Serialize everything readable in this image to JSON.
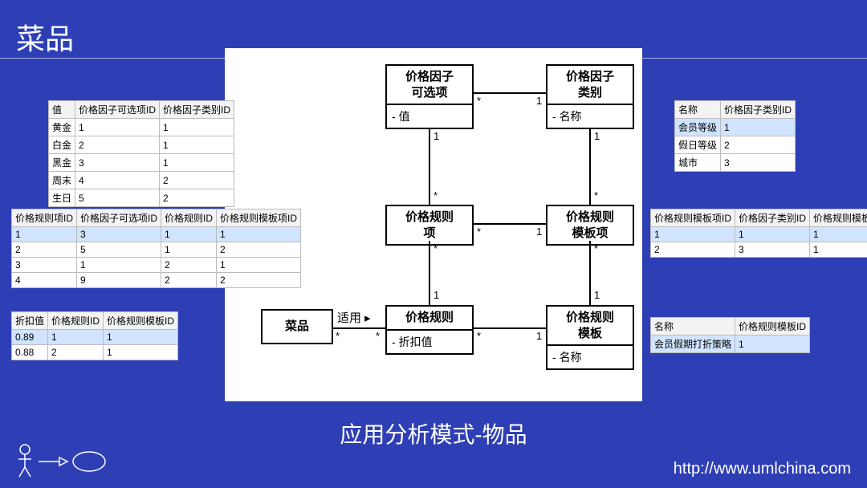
{
  "title": "菜品",
  "caption": "应用分析模式-物品",
  "footer_url": "http://www.umlchina.com",
  "uml": {
    "box1": {
      "title": "价格因子\n可选项",
      "attr": "值"
    },
    "box2": {
      "title": "价格因子\n类别",
      "attr": "名称"
    },
    "box3": {
      "title": "价格规则\n项"
    },
    "box4": {
      "title": "价格规则\n模板项"
    },
    "box5": {
      "title": "菜品"
    },
    "box6": {
      "title": "价格规则",
      "attr": "折扣值"
    },
    "box7": {
      "title": "价格规则\n模板",
      "attr": "名称"
    },
    "assoc_label": "适用 ▸"
  },
  "mult": {
    "one": "1",
    "many": "*"
  },
  "table1": {
    "headers": [
      "值",
      "价格因子可选项ID",
      "价格因子类别ID"
    ],
    "rows": [
      [
        "黄金",
        "1",
        "1"
      ],
      [
        "白金",
        "2",
        "1"
      ],
      [
        "黑金",
        "3",
        "1"
      ],
      [
        "周末",
        "4",
        "2"
      ],
      [
        "生日",
        "5",
        "2"
      ]
    ]
  },
  "table2": {
    "headers": [
      "价格规则项ID",
      "价格因子可选项ID",
      "价格规则ID",
      "价格规则模板项ID"
    ],
    "rows": [
      [
        "1",
        "3",
        "1",
        "1"
      ],
      [
        "2",
        "5",
        "1",
        "2"
      ],
      [
        "3",
        "1",
        "2",
        "1"
      ],
      [
        "4",
        "9",
        "2",
        "2"
      ]
    ]
  },
  "table3": {
    "headers": [
      "折扣值",
      "价格规则ID",
      "价格规则模板ID"
    ],
    "rows": [
      [
        "0.89",
        "1",
        "1"
      ],
      [
        "0.88",
        "2",
        "1"
      ]
    ]
  },
  "table4": {
    "headers": [
      "名称",
      "价格因子类别ID"
    ],
    "rows": [
      [
        "会员等级",
        "1"
      ],
      [
        "假日等级",
        "2"
      ],
      [
        "城市",
        "3"
      ]
    ]
  },
  "table5": {
    "headers": [
      "价格规则模板项ID",
      "价格因子类别ID",
      "价格规则模板ID"
    ],
    "rows": [
      [
        "1",
        "1",
        "1"
      ],
      [
        "2",
        "3",
        "1"
      ]
    ]
  },
  "table6": {
    "headers": [
      "名称",
      "价格规则模板ID"
    ],
    "rows": [
      [
        "会员假期打折策略",
        "1"
      ]
    ]
  }
}
